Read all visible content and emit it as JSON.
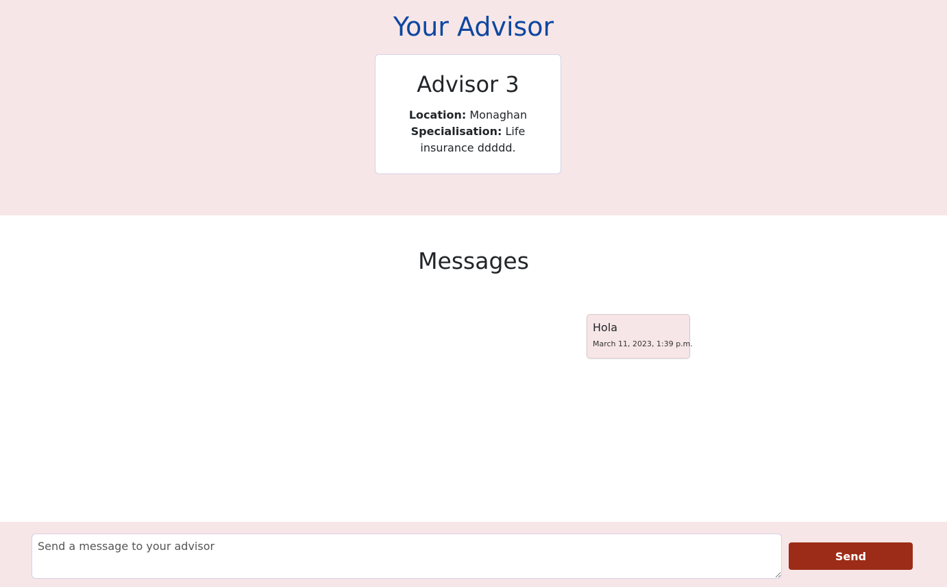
{
  "advisor_section": {
    "heading": "Your Advisor",
    "card": {
      "name": "Advisor 3",
      "location_label": "Location:",
      "location_value": "Monaghan",
      "specialisation_label": "Specialisation:",
      "specialisation_value": "Life insurance ddddd."
    }
  },
  "messages_section": {
    "heading": "Messages",
    "messages": [
      {
        "text": "Hola",
        "timestamp": "March 11, 2023, 1:39 p.m."
      }
    ]
  },
  "composer": {
    "placeholder": "Send a message to your advisor",
    "send_label": "Send"
  },
  "colors": {
    "section_background": "#f7e6e7",
    "heading_blue": "#0d47a1",
    "send_button": "#9c2c17"
  }
}
